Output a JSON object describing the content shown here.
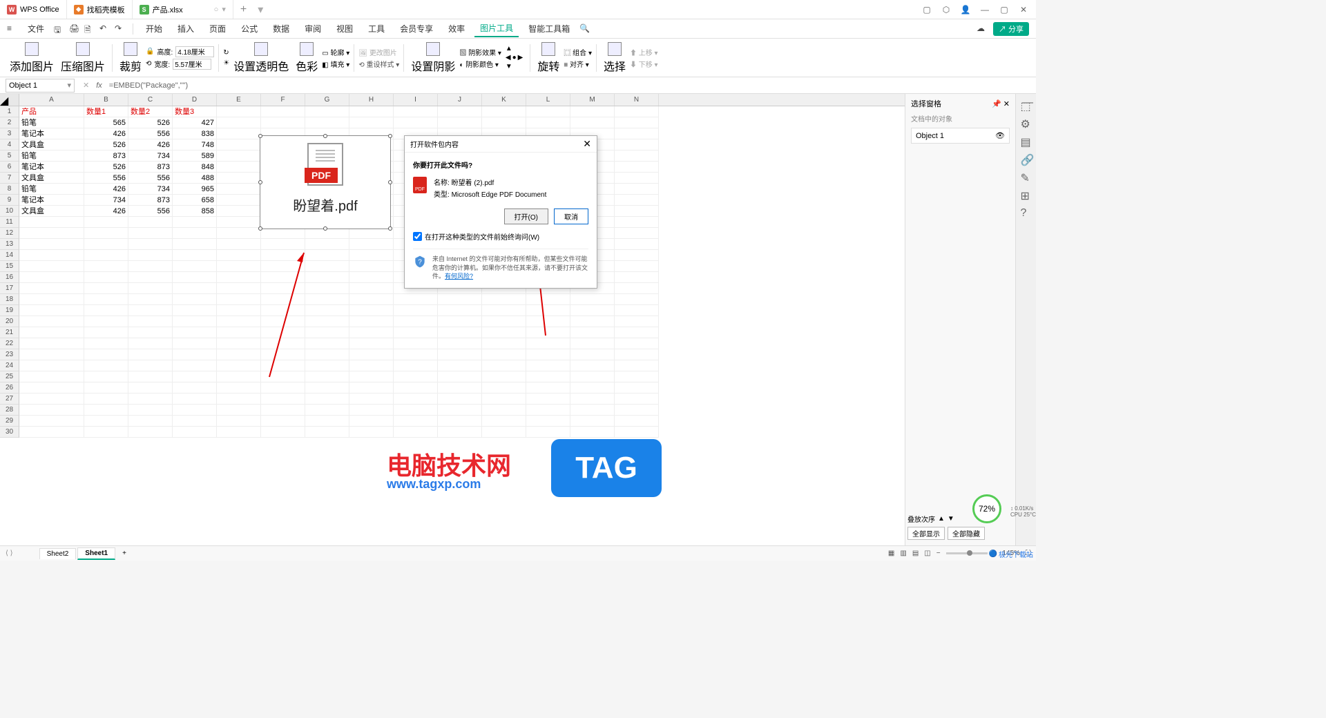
{
  "titlebar": {
    "tabs": [
      {
        "icon": "W",
        "label": "WPS Office",
        "color": "red"
      },
      {
        "icon": "◆",
        "label": "找稻壳模板",
        "color": "orange"
      },
      {
        "icon": "S",
        "label": "产品.xlsx",
        "color": "green",
        "active": true
      }
    ]
  },
  "menubar": {
    "file": "文件",
    "items": [
      "开始",
      "插入",
      "页面",
      "公式",
      "数据",
      "审阅",
      "视图",
      "工具",
      "会员专享",
      "效率",
      "图片工具",
      "智能工具箱"
    ],
    "active": "图片工具",
    "share": "分享"
  },
  "ribbon": {
    "add_image": "添加图片",
    "compress": "压缩图片",
    "crop": "裁剪",
    "height_label": "高度:",
    "height_value": "4.18厘米",
    "width_label": "宽度:",
    "width_value": "5.57厘米",
    "transparency": "设置透明色",
    "color": "色彩",
    "outline": "轮廓",
    "fill": "填充",
    "change_img": "更改图片",
    "reset_style": "重设样式",
    "shadow": "设置阴影",
    "shadow_effect": "阴影效果",
    "shadow_color": "阴影颜色",
    "rotate": "旋转",
    "group": "组合",
    "align": "对齐",
    "select": "选择",
    "move_up": "上移",
    "move_down": "下移"
  },
  "formula": {
    "name_box": "Object 1",
    "formula": "=EMBED(\"Package\",\"\")"
  },
  "columns": [
    "A",
    "B",
    "C",
    "D",
    "E",
    "F",
    "G",
    "H",
    "I",
    "J",
    "K",
    "L",
    "M",
    "N"
  ],
  "table": {
    "headers": [
      "产品",
      "数量1",
      "数量2",
      "数量3"
    ],
    "rows": [
      [
        "铅笔",
        "565",
        "526",
        "427"
      ],
      [
        "笔记本",
        "426",
        "556",
        "838"
      ],
      [
        "文具盒",
        "526",
        "426",
        "748"
      ],
      [
        "铅笔",
        "873",
        "734",
        "589"
      ],
      [
        "笔记本",
        "526",
        "873",
        "848"
      ],
      [
        "文具盒",
        "556",
        "556",
        "488"
      ],
      [
        "铅笔",
        "426",
        "734",
        "965"
      ],
      [
        "笔记本",
        "734",
        "873",
        "658"
      ],
      [
        "文具盒",
        "426",
        "556",
        "858"
      ]
    ]
  },
  "embedded": {
    "badge": "PDF",
    "label": "盼望着.pdf"
  },
  "dialog": {
    "title": "打开软件包内容",
    "question": "你要打开此文件吗?",
    "name_label": "名称:",
    "name_value": "盼望着 (2).pdf",
    "type_label": "类型:",
    "type_value": "Microsoft Edge PDF Document",
    "open_btn": "打开(O)",
    "cancel_btn": "取消",
    "checkbox": "在打开这种类型的文件前始终询问(W)",
    "warning": "来自 Internet 的文件可能对你有所帮助，但某些文件可能危害你的计算机。如果你不信任其来源，请不要打开该文件。",
    "risk_link": "有何风险?"
  },
  "panel": {
    "title": "选择窗格",
    "subtitle": "文档中的对象",
    "object": "Object 1",
    "stack_label": "叠放次序",
    "show_all": "全部显示",
    "hide_all": "全部隐藏"
  },
  "perf": {
    "percent": "72%",
    "speed": "0.01K/s",
    "cpu": "CPU 25°C"
  },
  "sheets": {
    "tabs": [
      "Sheet2",
      "Sheet1"
    ],
    "active": "Sheet1"
  },
  "status": {
    "zoom": "145%"
  },
  "watermark": {
    "title": "电脑技术网",
    "url": "www.tagxp.com",
    "tag": "TAG",
    "site": "极光下载站"
  }
}
